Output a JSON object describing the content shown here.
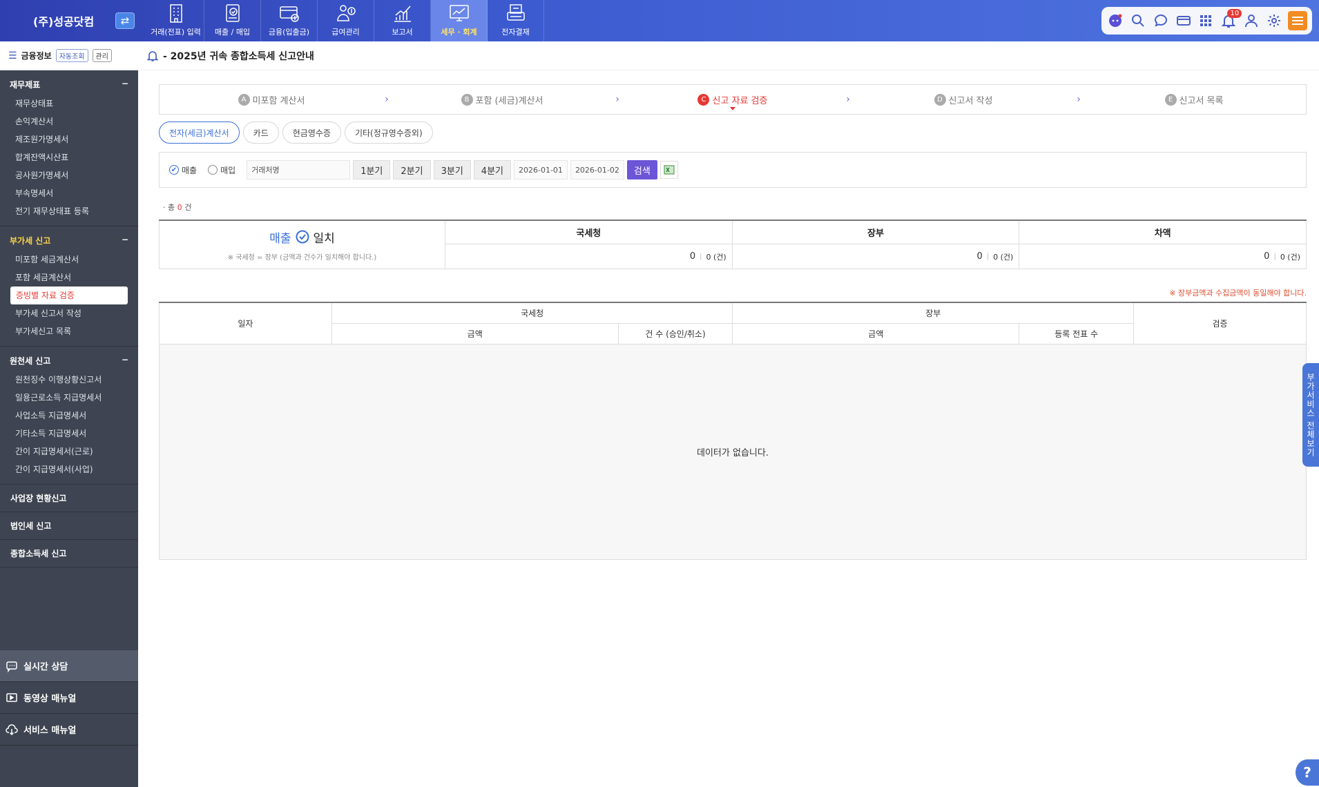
{
  "header": {
    "company": "(주)성공닷컴",
    "menu": [
      {
        "label": "거래(전표) 입력",
        "icon": "building-icon"
      },
      {
        "label": "매출 / 매입",
        "icon": "document-check-icon"
      },
      {
        "label": "금융(입출금)",
        "icon": "card-icon"
      },
      {
        "label": "급여관리",
        "icon": "payroll-icon"
      },
      {
        "label": "보고서",
        "icon": "chart-icon"
      },
      {
        "label": "세무 · 회계",
        "icon": "monitor-chart-icon"
      },
      {
        "label": "전자결재",
        "icon": "approval-icon"
      }
    ],
    "notification_count": "10"
  },
  "sidebar": {
    "head_title": "금융정보",
    "head_chip1": "자동조회",
    "head_chip2": "관리",
    "groups": [
      {
        "title": "재무제표",
        "items": [
          "재무상태표",
          "손익계산서",
          "제조원가명세서",
          "합계잔액시산표",
          "공사원가명세서",
          "부속명세서",
          "전기 재무상태표 등록"
        ]
      },
      {
        "title": "부가세 신고",
        "items": [
          "미포함 세금계산서",
          "포함 세금계산서",
          "증빙별 자료 검증",
          "부가세 신고서 작성",
          "부가세신고 목록"
        ]
      },
      {
        "title": "원천세 신고",
        "items": [
          "원천징수 이행상황신고서",
          "일용근로소득 지급명세서",
          "사업소득 지급명세서",
          "기타소득 지급명세서",
          "간이 지급명세서(근로)",
          "간이 지급명세서(사업)"
        ]
      }
    ],
    "singles": [
      "사업장 현황신고",
      "법인세 신고",
      "종합소득세 신고"
    ],
    "bottom": [
      "실시간 상담",
      "동영상 매뉴얼",
      "서비스 매뉴얼"
    ]
  },
  "main": {
    "notice": "- 2025년 귀속 종합소득세 신고안내",
    "steps": [
      {
        "letter": "A",
        "label": "미포함 계산서"
      },
      {
        "letter": "B",
        "label": "포함 (세금)계산서"
      },
      {
        "letter": "C",
        "label": "신고 자료 검증"
      },
      {
        "letter": "D",
        "label": "신고서 작성"
      },
      {
        "letter": "E",
        "label": "신고서 목록"
      }
    ],
    "tabs": [
      "전자(세금)계산서",
      "카드",
      "현금영수증",
      "기타(정규영수증외)"
    ],
    "filter": {
      "radio_sales": "매출",
      "radio_purchase": "매입",
      "partner_placeholder": "거래처명",
      "quarters": [
        "1분기",
        "2분기",
        "3분기",
        "4분기"
      ],
      "date_from": "2026-01-01",
      "date_to": "2026-01-02",
      "search": "검색"
    },
    "count_prefix": "· 총",
    "count_value": "0",
    "count_suffix": "건",
    "summary": {
      "title_a": "매출",
      "title_b": "일치",
      "note": "※ 국세청 = 장부 (금액과 건수가 일치해야 합니다.)",
      "cols": [
        {
          "header": "국세청",
          "amount": "0",
          "count": "0 (건)"
        },
        {
          "header": "장부",
          "amount": "0",
          "count": "0 (건)"
        },
        {
          "header": "차액",
          "amount": "0",
          "count": "0 (건)"
        }
      ]
    },
    "warning": "※ 장부금액과 수집금액이 동일해야 합니다.",
    "grid": {
      "date": "일자",
      "nts": "국세청",
      "book": "장부",
      "verify": "검증",
      "amount": "금액",
      "count": "건 수 (승인/취소)",
      "book_amount": "금액",
      "book_count": "등록 전표 수",
      "empty": "데이터가 없습니다."
    },
    "float_label": "부가서비스 전체보기",
    "help": "?"
  }
}
